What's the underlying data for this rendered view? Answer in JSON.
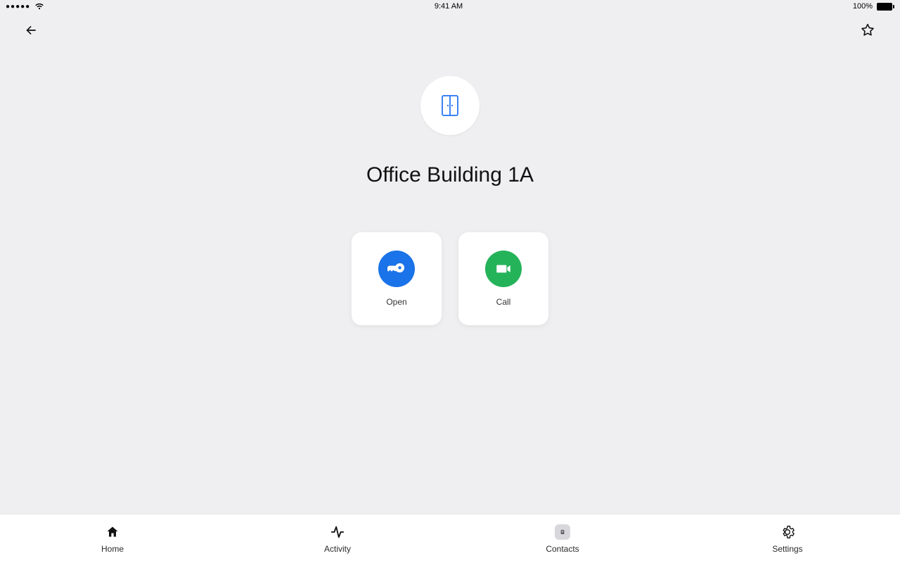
{
  "status_bar": {
    "signal_text": "●●●●●",
    "time": "9:41 AM",
    "battery_text": "100%"
  },
  "header": {
    "back_icon": "back-arrow",
    "favorite_icon": "star-outline"
  },
  "main": {
    "avatar_icon": "door-icon",
    "title": "Office Building 1A",
    "actions": [
      {
        "id": "open",
        "label": "Open",
        "icon": "key-icon",
        "circle_color": "#1a73e8"
      },
      {
        "id": "call",
        "label": "Call",
        "icon": "video-icon",
        "circle_color": "#25b35a"
      }
    ]
  },
  "tabs": [
    {
      "id": "home",
      "label": "Home",
      "icon": "home-icon",
      "active": false
    },
    {
      "id": "activity",
      "label": "Activity",
      "icon": "activity-icon",
      "active": false
    },
    {
      "id": "contacts",
      "label": "Contacts",
      "icon": "contacts-icon",
      "active": true
    },
    {
      "id": "settings",
      "label": "Settings",
      "icon": "settings-icon",
      "active": false
    }
  ]
}
